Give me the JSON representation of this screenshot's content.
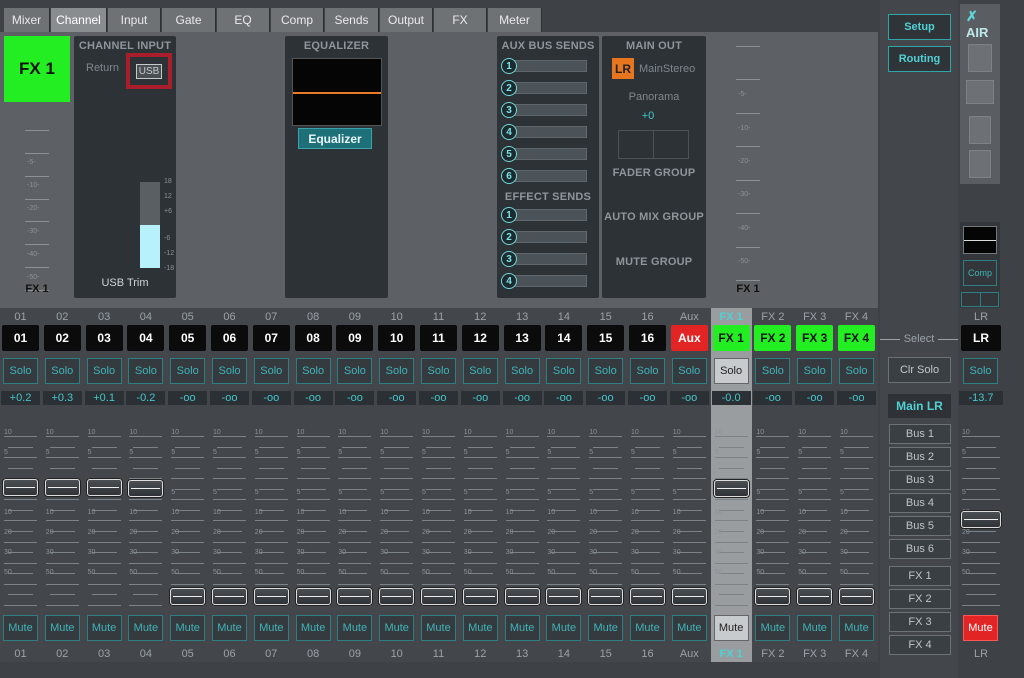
{
  "tabs": [
    "Mixer",
    "Channel",
    "Input",
    "Gate",
    "EQ",
    "Comp",
    "Sends",
    "Output",
    "FX",
    "Meter"
  ],
  "active_tab": "Channel",
  "channel": {
    "name": "FX 1",
    "color": "#22ee22"
  },
  "meter_scale": [
    "-5-",
    "-10-",
    "-20-",
    "-30-",
    "-40-",
    "-50-"
  ],
  "meter_label": "FX 1",
  "channel_input": {
    "title": "CHANNEL INPUT",
    "source_label": "Return",
    "usb_label": "USB",
    "trim_label": "USB Trim",
    "trim_scale": [
      "18",
      "12",
      "+6",
      "-6",
      "-12",
      "-18"
    ]
  },
  "equalizer": {
    "title": "EQUALIZER",
    "button": "Equalizer"
  },
  "aux_bus_sends": {
    "title": "AUX BUS SENDS",
    "buses": [
      "1",
      "2",
      "3",
      "4",
      "5",
      "6"
    ]
  },
  "effect_sends": {
    "title": "EFFECT SENDS",
    "sends": [
      "1",
      "2",
      "3",
      "4"
    ]
  },
  "main_out": {
    "title": "MAIN OUT",
    "lr_badge": "LR",
    "target": "MainStereo",
    "panorama_label": "Panorama",
    "panorama_value": "+0",
    "fader_group": "FADER GROUP",
    "auto_mix_group": "AUTO MIX GROUP",
    "mute_group": "MUTE GROUP"
  },
  "right_meter": {
    "scale": [
      "-5-",
      "-10-",
      "-20-",
      "-30-",
      "-40-",
      "-50-"
    ],
    "label": "FX 1"
  },
  "sidebar": {
    "setup": "Setup",
    "routing": "Routing",
    "logo": "AIR",
    "comp": "Comp"
  },
  "strips": [
    {
      "top": "01",
      "name": "01",
      "solo": "Solo",
      "level": "+0.2",
      "mute": "Mute",
      "bottom": "01",
      "type": "ch",
      "fader": 0.78
    },
    {
      "top": "02",
      "name": "02",
      "solo": "Solo",
      "level": "+0.3",
      "mute": "Mute",
      "bottom": "02",
      "type": "ch",
      "fader": 0.78
    },
    {
      "top": "03",
      "name": "03",
      "solo": "Solo",
      "level": "+0.1",
      "mute": "Mute",
      "bottom": "03",
      "type": "ch",
      "fader": 0.78
    },
    {
      "top": "04",
      "name": "04",
      "solo": "Solo",
      "level": "-0.2",
      "mute": "Mute",
      "bottom": "04",
      "type": "ch",
      "fader": 0.77
    },
    {
      "top": "05",
      "name": "05",
      "solo": "Solo",
      "level": "-oo",
      "mute": "Mute",
      "bottom": "05",
      "type": "ch",
      "fader": 0
    },
    {
      "top": "06",
      "name": "06",
      "solo": "Solo",
      "level": "-oo",
      "mute": "Mute",
      "bottom": "06",
      "type": "ch",
      "fader": 0
    },
    {
      "top": "07",
      "name": "07",
      "solo": "Solo",
      "level": "-oo",
      "mute": "Mute",
      "bottom": "07",
      "type": "ch",
      "fader": 0
    },
    {
      "top": "08",
      "name": "08",
      "solo": "Solo",
      "level": "-oo",
      "mute": "Mute",
      "bottom": "08",
      "type": "ch",
      "fader": 0
    },
    {
      "top": "09",
      "name": "09",
      "solo": "Solo",
      "level": "-oo",
      "mute": "Mute",
      "bottom": "09",
      "type": "ch",
      "fader": 0
    },
    {
      "top": "10",
      "name": "10",
      "solo": "Solo",
      "level": "-oo",
      "mute": "Mute",
      "bottom": "10",
      "type": "ch",
      "fader": 0
    },
    {
      "top": "11",
      "name": "11",
      "solo": "Solo",
      "level": "-oo",
      "mute": "Mute",
      "bottom": "11",
      "type": "ch",
      "fader": 0
    },
    {
      "top": "12",
      "name": "12",
      "solo": "Solo",
      "level": "-oo",
      "mute": "Mute",
      "bottom": "12",
      "type": "ch",
      "fader": 0
    },
    {
      "top": "13",
      "name": "13",
      "solo": "Solo",
      "level": "-oo",
      "mute": "Mute",
      "bottom": "13",
      "type": "ch",
      "fader": 0
    },
    {
      "top": "14",
      "name": "14",
      "solo": "Solo",
      "level": "-oo",
      "mute": "Mute",
      "bottom": "14",
      "type": "ch",
      "fader": 0
    },
    {
      "top": "15",
      "name": "15",
      "solo": "Solo",
      "level": "-oo",
      "mute": "Mute",
      "bottom": "15",
      "type": "ch",
      "fader": 0
    },
    {
      "top": "16",
      "name": "16",
      "solo": "Solo",
      "level": "-oo",
      "mute": "Mute",
      "bottom": "16",
      "type": "ch",
      "fader": 0
    },
    {
      "top": "Aux",
      "name": "Aux",
      "solo": "Solo",
      "level": "-oo",
      "mute": "Mute",
      "bottom": "Aux",
      "type": "aux",
      "fader": 0
    },
    {
      "top": "FX 1",
      "name": "FX 1",
      "solo": "Solo",
      "level": "-0.0",
      "mute": "Mute",
      "bottom": "FX 1",
      "type": "fxsel",
      "fader": 0.77
    },
    {
      "top": "FX 2",
      "name": "FX 2",
      "solo": "Solo",
      "level": "-oo",
      "mute": "Mute",
      "bottom": "FX 2",
      "type": "fx",
      "fader": 0
    },
    {
      "top": "FX 3",
      "name": "FX 3",
      "solo": "Solo",
      "level": "-oo",
      "mute": "Mute",
      "bottom": "FX 3",
      "type": "fx",
      "fader": 0
    },
    {
      "top": "FX 4",
      "name": "FX 4",
      "solo": "Solo",
      "level": "-oo",
      "mute": "Mute",
      "bottom": "FX 4",
      "type": "fx",
      "fader": 0
    }
  ],
  "fader_scale": [
    "10",
    "5",
    "",
    "5",
    "10",
    "20",
    "30",
    "50"
  ],
  "select_label": "Select",
  "clr_solo": "Clr Solo",
  "main_lr_btn": "Main LR",
  "buses": [
    "Bus 1",
    "Bus 2",
    "Bus 3",
    "Bus 4",
    "Bus 5",
    "Bus 6"
  ],
  "fx_buses": [
    "FX 1",
    "FX 2",
    "FX 3",
    "FX 4"
  ],
  "lr_strip": {
    "top": "LR",
    "name": "LR",
    "solo": "Solo",
    "level": "-13.7",
    "mute": "Mute",
    "bottom": "LR",
    "fader": 0.55
  }
}
